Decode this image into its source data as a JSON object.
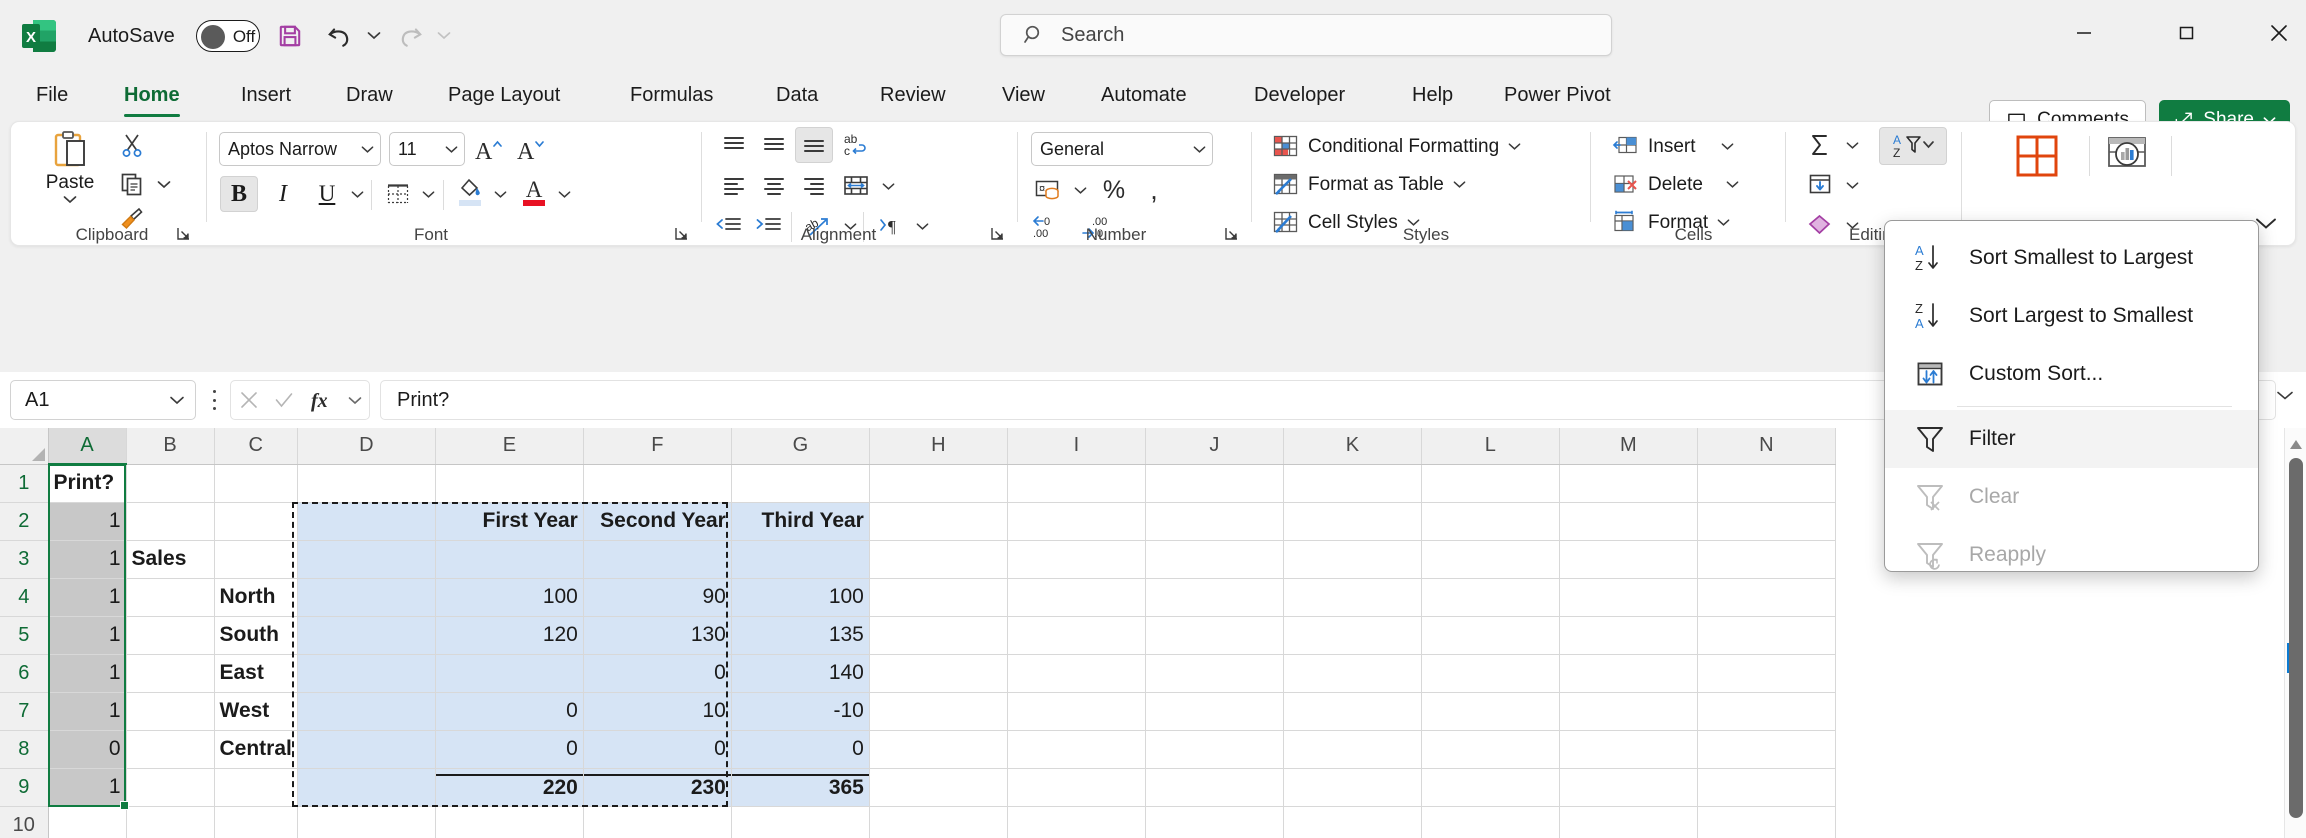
{
  "titlebar": {
    "app_icon": "excel-logo",
    "autosave_label": "AutoSave",
    "autosave_state": "Off",
    "save_icon": "save-icon",
    "undo_icon": "undo-icon",
    "redo_icon": "redo-icon",
    "search_placeholder": "Search",
    "search_icon": "search-icon",
    "minimize_icon": "minimize-icon",
    "maximize_icon": "maximize-icon",
    "close_icon": "close-icon"
  },
  "tabs": [
    {
      "label": "File",
      "active": false
    },
    {
      "label": "Home",
      "active": true
    },
    {
      "label": "Insert",
      "active": false
    },
    {
      "label": "Draw",
      "active": false
    },
    {
      "label": "Page Layout",
      "active": false
    },
    {
      "label": "Formulas",
      "active": false
    },
    {
      "label": "Data",
      "active": false
    },
    {
      "label": "Review",
      "active": false
    },
    {
      "label": "View",
      "active": false
    },
    {
      "label": "Automate",
      "active": false
    },
    {
      "label": "Developer",
      "active": false
    },
    {
      "label": "Help",
      "active": false
    },
    {
      "label": "Power Pivot",
      "active": false
    }
  ],
  "header_actions": {
    "comments_label": "Comments",
    "comments_icon": "comment-icon",
    "share_label": "Share",
    "share_icon": "share-icon",
    "share_chevron": "chevron-down-icon"
  },
  "ribbon": {
    "groups": [
      {
        "name": "Clipboard",
        "label": "Clipboard"
      },
      {
        "name": "Font",
        "label": "Font"
      },
      {
        "name": "Alignment",
        "label": "Alignment"
      },
      {
        "name": "Number",
        "label": "Number"
      },
      {
        "name": "Styles",
        "label": "Styles"
      },
      {
        "name": "Cells",
        "label": "Cells"
      },
      {
        "name": "Editing",
        "label": "Editing"
      }
    ],
    "clipboard": {
      "paste_label": "Paste",
      "paste_icon": "paste-icon",
      "cut_icon": "scissors-icon",
      "copy_icon": "copy-icon",
      "format_painter_icon": "format-painter-icon"
    },
    "font": {
      "font_name": "Aptos Narrow",
      "font_size": "11",
      "grow_font_icon": "increase-font-size-icon",
      "shrink_font_icon": "decrease-font-size-icon",
      "bold_label": "B",
      "italic_label": "I",
      "underline_label": "U",
      "borders_icon": "borders-icon",
      "fill_color_icon": "fill-color-icon",
      "font_color_icon": "font-color-icon",
      "bold_active": true
    },
    "alignment": {
      "top_align_icon": "align-top-icon",
      "middle_align_icon": "align-middle-icon",
      "bottom_align_icon": "align-bottom-icon",
      "wrap_text_icon": "wrap-text-icon",
      "align_left_icon": "align-left-icon",
      "align_center_icon": "align-center-icon",
      "align_right_icon": "align-right-icon",
      "merge_center_icon": "merge-and-center-icon",
      "decrease_indent_icon": "decrease-indent-icon",
      "increase_indent_icon": "increase-indent-icon",
      "orientation_icon": "text-orientation-icon",
      "text_direction_icon": "text-direction-icon"
    },
    "number": {
      "format_value": "General",
      "accounting_icon": "accounting-number-format-icon",
      "percent_icon": "percent-style-icon",
      "comma_icon": "comma-style-icon",
      "increase_decimal_icon": "increase-decimal-icon",
      "decrease_decimal_icon": "decrease-decimal-icon"
    },
    "styles": {
      "conditional_formatting_label": "Conditional Formatting",
      "conditional_formatting_icon": "conditional-formatting-icon",
      "format_as_table_label": "Format as Table",
      "format_as_table_icon": "format-as-table-icon",
      "cell_styles_label": "Cell Styles",
      "cell_styles_icon": "cell-styles-icon"
    },
    "cells": {
      "insert_label": "Insert",
      "insert_icon": "insert-cells-icon",
      "delete_label": "Delete",
      "delete_icon": "delete-cells-icon",
      "format_label": "Format",
      "format_icon": "format-cells-icon"
    },
    "editing": {
      "autosum_icon": "autosum-icon",
      "fill_icon": "fill-icon",
      "clear_icon": "clear-icon",
      "sort_filter_icon": "sort-and-filter-icon",
      "sort_filter_active": true
    },
    "right_tools": {
      "analyze_data_icon": "cells-orange-icon",
      "ideas_icon": "analyze-data-icon"
    },
    "collapse_icon": "chevron-down-icon"
  },
  "sort_filter_menu": {
    "items": [
      {
        "label": "Sort Smallest to Largest",
        "icon": "sort-az-icon",
        "accel": "S",
        "disabled": false,
        "hover": false
      },
      {
        "label": "Sort Largest to Smallest",
        "icon": "sort-za-icon",
        "accel": "o",
        "disabled": false,
        "hover": false
      },
      {
        "label": "Custom Sort...",
        "icon": "custom-sort-icon",
        "accel": "u",
        "disabled": false,
        "hover": false
      },
      {
        "separator": true
      },
      {
        "label": "Filter",
        "icon": "filter-icon",
        "accel": "F",
        "disabled": false,
        "hover": true
      },
      {
        "label": "Clear",
        "icon": "clear-filter-icon",
        "accel": "C",
        "disabled": true,
        "hover": false
      },
      {
        "label": "Reapply",
        "icon": "reapply-filter-icon",
        "accel": "y",
        "disabled": true,
        "hover": false
      }
    ]
  },
  "formula_bar": {
    "name_box_value": "A1",
    "name_box_chevron": "chevron-down-icon",
    "cancel_icon": "cancel-icon",
    "enter_icon": "enter-icon",
    "fx_icon": "insert-function-icon",
    "fx_chevron": "chevron-down-icon",
    "formula_value": "Print?",
    "expand_icon": "expand-formula-bar-icon"
  },
  "grid": {
    "columns": [
      "A",
      "B",
      "C",
      "D",
      "E",
      "F",
      "G",
      "H",
      "I",
      "J",
      "K",
      "L",
      "M",
      "N"
    ],
    "selected_columns": [
      "A"
    ],
    "rows": [
      "1",
      "2",
      "3",
      "4",
      "5",
      "6",
      "7",
      "8",
      "9",
      "10"
    ],
    "selected_rows": [
      "1",
      "2",
      "3",
      "4",
      "5",
      "6",
      "7",
      "8",
      "9"
    ],
    "cells": [
      {
        "row": "1",
        "A": "Print?",
        "B": "",
        "C": "",
        "D": "",
        "E": "",
        "F": "",
        "G": ""
      },
      {
        "row": "2",
        "A": "1",
        "B": "",
        "C": "",
        "D": "",
        "E": "First Year",
        "F": "Second Year",
        "G": "Third Year"
      },
      {
        "row": "3",
        "A": "1",
        "B": "Sales",
        "C": "",
        "D": "",
        "E": "",
        "F": "",
        "G": ""
      },
      {
        "row": "4",
        "A": "1",
        "B": "",
        "C": "North",
        "D": "",
        "E": "100",
        "F": "90",
        "G": "100"
      },
      {
        "row": "5",
        "A": "1",
        "B": "",
        "C": "South",
        "D": "",
        "E": "120",
        "F": "130",
        "G": "135"
      },
      {
        "row": "6",
        "A": "1",
        "B": "",
        "C": "East",
        "D": "",
        "E": "",
        "F": "0",
        "G": "140"
      },
      {
        "row": "7",
        "A": "1",
        "B": "",
        "C": "West",
        "D": "",
        "E": "0",
        "F": "10",
        "G": "-10"
      },
      {
        "row": "8",
        "A": "0",
        "B": "",
        "C": "Central",
        "D": "",
        "E": "0",
        "F": "0",
        "G": "0"
      },
      {
        "row": "9",
        "A": "1",
        "B": "",
        "C": "",
        "D": "",
        "E": "220",
        "F": "230",
        "G": "365"
      },
      {
        "row": "10",
        "A": "",
        "B": "",
        "C": "",
        "D": "",
        "E": "",
        "F": "",
        "G": ""
      }
    ],
    "active_cell": "A1",
    "selection_range": "A1:A9",
    "copy_marquee_range": "D2:G9"
  },
  "colors": {
    "excel_green": "#107c41",
    "selection_green": "#107c41",
    "copy_fill_blue": "#d6e4f5",
    "selected_header_gray": "#c8c8c8",
    "accent_blue": "#0b7ad1"
  }
}
